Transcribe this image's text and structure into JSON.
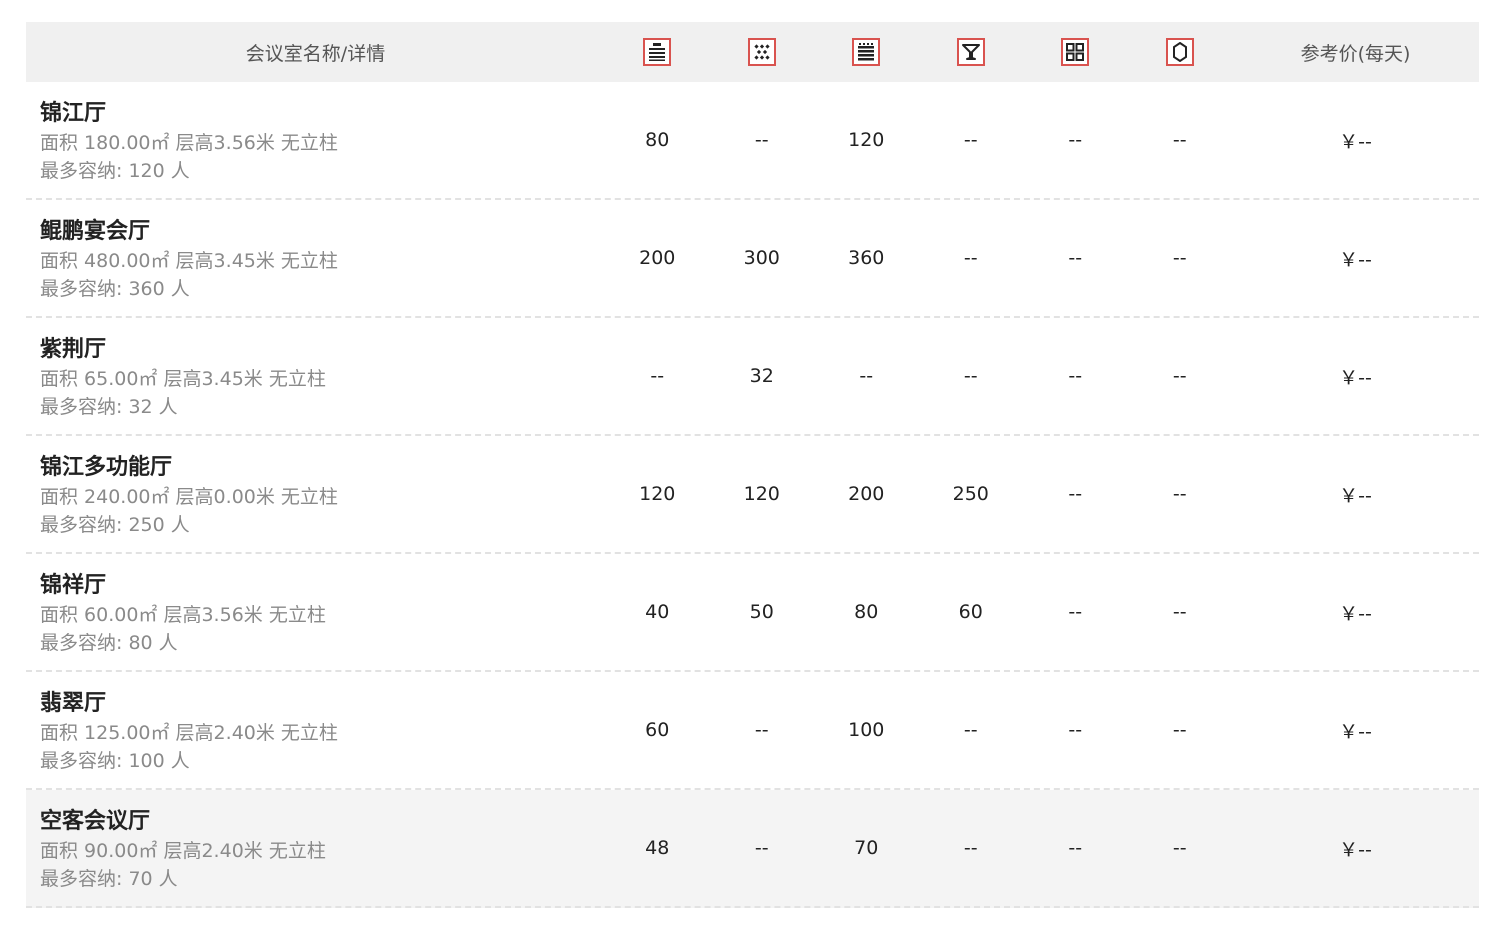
{
  "table": {
    "header": {
      "name_label": "会议室名称/详情",
      "price_label": "参考价(每天)",
      "layout_icons": [
        "theater-layout-icon",
        "banquet-layout-icon",
        "classroom-layout-icon",
        "cocktail-layout-icon",
        "u-shape-layout-icon",
        "boardroom-layout-icon"
      ]
    },
    "rows": [
      {
        "name": "锦江厅",
        "spec": "面积 180.00㎡ 层高3.56米 无立柱",
        "capacity": "最多容纳: 120 人",
        "values": [
          "80",
          "--",
          "120",
          "--",
          "--",
          "--"
        ],
        "price": "￥--"
      },
      {
        "name": "鲲鹏宴会厅",
        "spec": "面积 480.00㎡ 层高3.45米 无立柱",
        "capacity": "最多容纳: 360 人",
        "values": [
          "200",
          "300",
          "360",
          "--",
          "--",
          "--"
        ],
        "price": "￥--"
      },
      {
        "name": "紫荆厅",
        "spec": "面积 65.00㎡ 层高3.45米 无立柱",
        "capacity": "最多容纳: 32 人",
        "values": [
          "--",
          "32",
          "--",
          "--",
          "--",
          "--"
        ],
        "price": "￥--"
      },
      {
        "name": "锦江多功能厅",
        "spec": "面积 240.00㎡ 层高0.00米 无立柱",
        "capacity": "最多容纳: 250 人",
        "values": [
          "120",
          "120",
          "200",
          "250",
          "--",
          "--"
        ],
        "price": "￥--"
      },
      {
        "name": "锦祥厅",
        "spec": "面积 60.00㎡ 层高3.56米 无立柱",
        "capacity": "最多容纳: 80 人",
        "values": [
          "40",
          "50",
          "80",
          "60",
          "--",
          "--"
        ],
        "price": "￥--"
      },
      {
        "name": "翡翠厅",
        "spec": "面积 125.00㎡ 层高2.40米 无立柱",
        "capacity": "最多容纳: 100 人",
        "values": [
          "60",
          "--",
          "100",
          "--",
          "--",
          "--"
        ],
        "price": "￥--"
      },
      {
        "name": "空客会议厅",
        "spec": "面积 90.00㎡ 层高2.40米 无立柱",
        "capacity": "最多容纳: 70 人",
        "values": [
          "48",
          "--",
          "70",
          "--",
          "--",
          "--"
        ],
        "price": "￥--"
      }
    ]
  },
  "colors": {
    "header_bg": "#f0f0f0",
    "icon_border": "#d9534f",
    "row_highlight": "#f4f4f4"
  }
}
